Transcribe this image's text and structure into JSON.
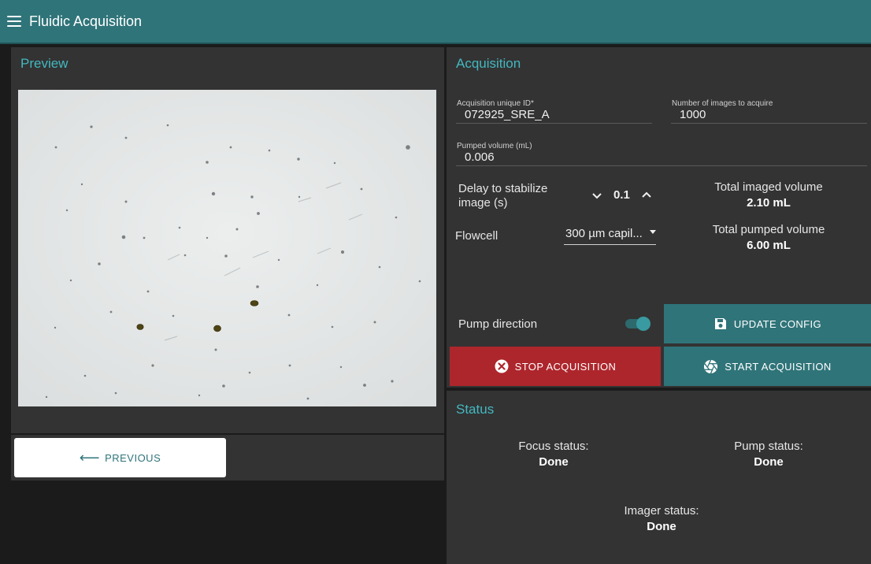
{
  "app": {
    "title": "Fluidic Acquisition"
  },
  "preview": {
    "title": "Preview",
    "previous_label": "PREVIOUS"
  },
  "acquisition": {
    "title": "Acquisition",
    "id_label": "Acquisition unique ID*",
    "id_value": "072925_SRE_A",
    "num_images_label": "Number of images to acquire",
    "num_images_value": "1000",
    "pumped_volume_label": "Pumped volume (mL)",
    "pumped_volume_value": "0.006",
    "delay_label_line1": "Delay to stabilize",
    "delay_label_line2": "image (s)",
    "delay_value": "0.1",
    "flowcell_label": "Flowcell",
    "flowcell_value": "300 µm capil...",
    "total_imaged_label": "Total imaged volume",
    "total_imaged_value": "2.10 mL",
    "total_pumped_label": "Total pumped volume",
    "total_pumped_value": "6.00 mL",
    "pump_direction_label": "Pump direction",
    "pump_direction_on": true,
    "update_config_label": "UPDATE CONFIG",
    "stop_label": "STOP ACQUISITION",
    "start_label": "START ACQUISITION"
  },
  "status": {
    "title": "Status",
    "focus_label": "Focus status:",
    "focus_value": "Done",
    "pump_label": "Pump status:",
    "pump_value": "Done",
    "imager_label": "Imager status:",
    "imager_value": "Done"
  },
  "colors": {
    "accent": "#2f7479",
    "title_cyan": "#43b8c0",
    "stop_red": "#ad262c",
    "panel": "#333333",
    "background": "#1b1b1b"
  },
  "icons": {
    "menu": "menu-icon",
    "back": "arrow-left-icon",
    "save": "save-icon",
    "stop": "cancel-circle-icon",
    "start": "camera-shutter-icon",
    "chevron_down": "chevron-down-icon",
    "chevron_up": "chevron-up-icon"
  }
}
